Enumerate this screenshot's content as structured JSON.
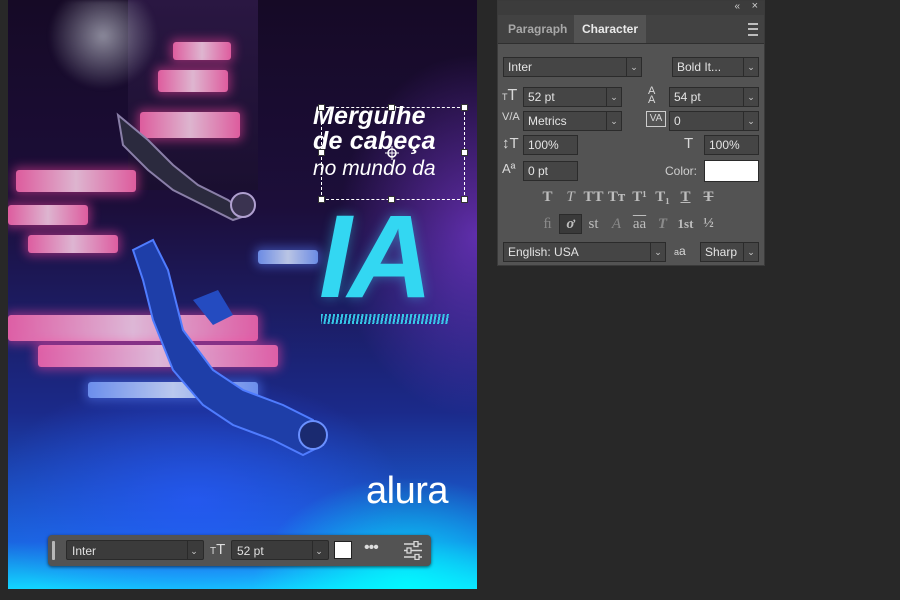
{
  "canvas": {
    "headline_line1": "Mergulhe",
    "headline_line2": "de cabeça",
    "headline_line3": "no mundo da",
    "big_text": "IA",
    "logo": "alura"
  },
  "taskbar": {
    "font": "Inter",
    "font_size": "52 pt",
    "more_label": "•••",
    "color": "#ffffff"
  },
  "panel": {
    "tabs": [
      "Paragraph",
      "Character"
    ],
    "active_tab": "Character",
    "font_family": "Inter",
    "font_style": "Bold It...",
    "font_size": "52 pt",
    "leading": "54 pt",
    "kerning": "Metrics",
    "tracking": "0",
    "vertical_scale": "100%",
    "horizontal_scale": "100%",
    "baseline_shift": "0 pt",
    "color_label": "Color:",
    "color": "#ffffff",
    "language": "English: USA",
    "aa_label": "a",
    "antialias": "Sharp",
    "type_style_buttons": [
      "T",
      "T",
      "TT",
      "Tт",
      "T¹",
      "T₁",
      "T",
      "T"
    ],
    "opentype_buttons": [
      "ﬁ",
      "ơ",
      "st",
      "A",
      "aa",
      "T",
      "1st",
      "½"
    ]
  },
  "colors": {
    "accent_cyan": "#33d7f2",
    "panel_bg": "#535353",
    "app_bg": "#282828"
  }
}
